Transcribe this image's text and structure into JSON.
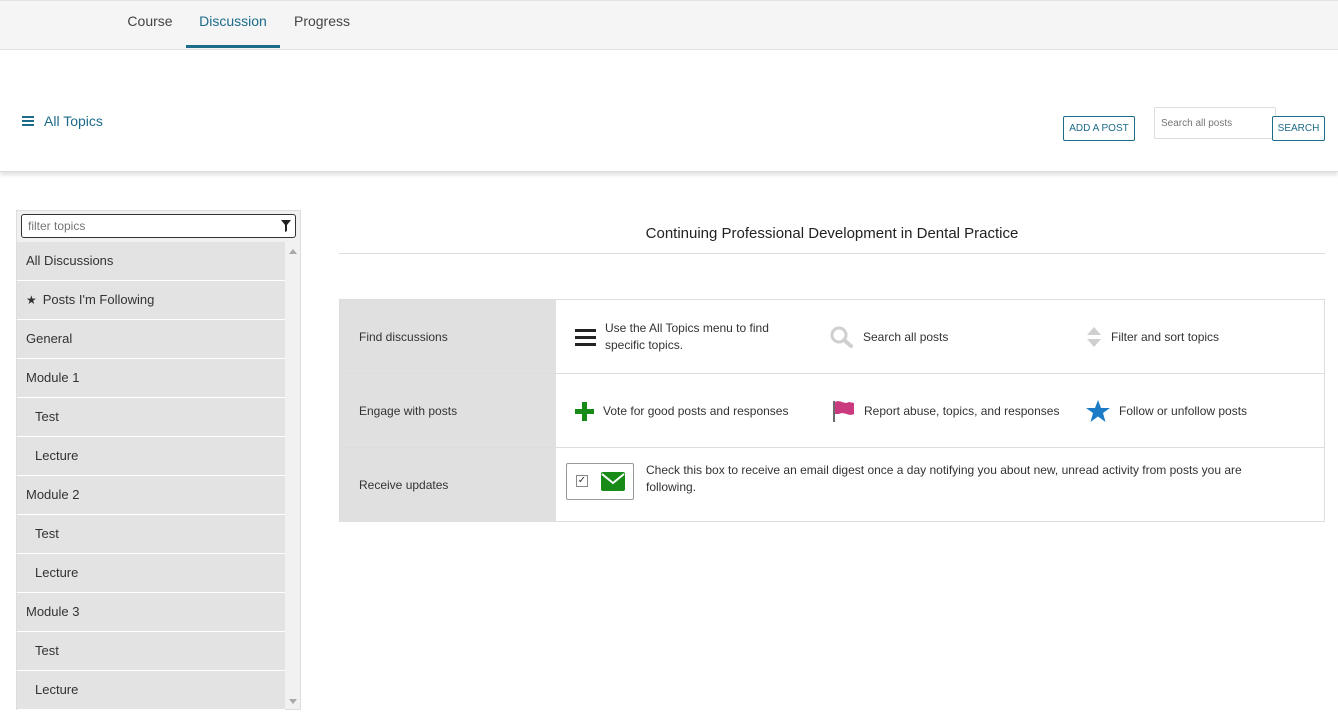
{
  "tabs": [
    {
      "label": "Course",
      "active": false
    },
    {
      "label": "Discussion",
      "active": true
    },
    {
      "label": "Progress",
      "active": false
    }
  ],
  "header": {
    "all_topics_label": "All Topics",
    "add_post_label": "ADD A POST",
    "search_placeholder": "Search all posts",
    "search_button_label": "SEARCH"
  },
  "sidebar": {
    "filter_placeholder": "filter topics",
    "topics": [
      {
        "label": "All Discussions",
        "level": 0
      },
      {
        "label": "Posts I'm Following",
        "level": 0,
        "icon": "star-icon"
      },
      {
        "label": "General",
        "level": 0
      },
      {
        "label": "Module 1",
        "level": 0
      },
      {
        "label": "Test",
        "level": 1
      },
      {
        "label": "Lecture",
        "level": 1
      },
      {
        "label": "Module 2",
        "level": 0
      },
      {
        "label": "Test",
        "level": 1
      },
      {
        "label": "Lecture",
        "level": 1
      },
      {
        "label": "Module 3",
        "level": 0
      },
      {
        "label": "Test",
        "level": 1
      },
      {
        "label": "Lecture",
        "level": 1
      }
    ]
  },
  "main": {
    "course_title": "Continuing Professional Development in Dental Practice",
    "guide": {
      "find": {
        "heading": "Find discussions",
        "menu_text": "Use the All Topics menu to find specific topics.",
        "search_text": "Search all posts",
        "filter_text": "Filter and sort topics"
      },
      "engage": {
        "heading": "Engage with posts",
        "vote_text": "Vote for good posts and responses",
        "report_text": "Report abuse, topics, and responses",
        "follow_text": "Follow or unfollow posts"
      },
      "receive": {
        "heading": "Receive updates",
        "checked": true,
        "text": "Check this box to receive an email digest once a day notifying you about new, unread activity from posts you are following."
      }
    }
  },
  "colors": {
    "accent": "#1b6b89",
    "vote_green": "#188a18",
    "flag_pink": "#c93a7e",
    "star_blue": "#1c7bc6",
    "mail_green": "#188a18"
  }
}
